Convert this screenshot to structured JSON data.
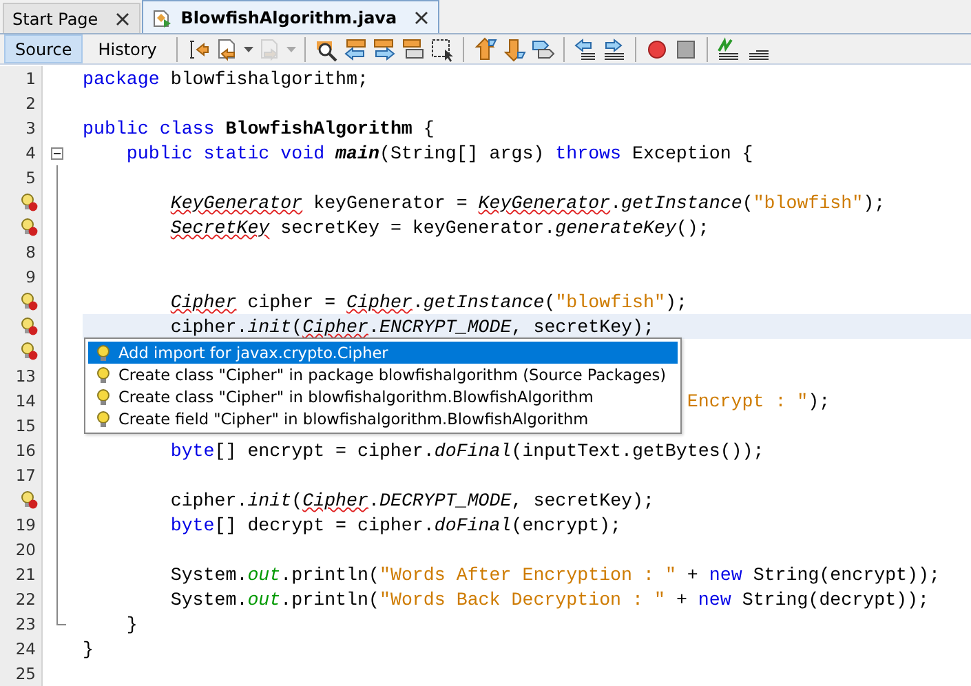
{
  "tabs": [
    {
      "label": "Start Page",
      "selected": false,
      "file_icon": false
    },
    {
      "label": "BlowfishAlgorithm.java",
      "selected": true,
      "file_icon": true
    }
  ],
  "view_buttons": [
    {
      "label": "Source",
      "selected": true
    },
    {
      "label": "History",
      "selected": false
    }
  ],
  "toolbar": [
    {
      "kind": "jump",
      "disabled": false
    },
    {
      "kind": "doc-back",
      "disabled": false,
      "dropdown": true
    },
    {
      "kind": "doc-forward",
      "disabled": true,
      "dropdown": true
    },
    {
      "kind": "sep"
    },
    {
      "kind": "search",
      "disabled": false
    },
    {
      "kind": "find-prev",
      "disabled": false
    },
    {
      "kind": "find-next",
      "disabled": false
    },
    {
      "kind": "highlight",
      "disabled": false
    },
    {
      "kind": "select",
      "disabled": false
    },
    {
      "kind": "sep"
    },
    {
      "kind": "up",
      "disabled": false
    },
    {
      "kind": "down",
      "disabled": false
    },
    {
      "kind": "tags",
      "disabled": false
    },
    {
      "kind": "sep"
    },
    {
      "kind": "shift-left",
      "disabled": false
    },
    {
      "kind": "shift-right",
      "disabled": false
    },
    {
      "kind": "sep"
    },
    {
      "kind": "record",
      "disabled": false
    },
    {
      "kind": "stop",
      "disabled": false
    },
    {
      "kind": "sep"
    },
    {
      "kind": "comment",
      "disabled": false
    },
    {
      "kind": "lines",
      "disabled": false
    }
  ],
  "lines": [
    {
      "number": "1",
      "hint": false,
      "current": false,
      "tokens": [
        {
          "kind": "kw",
          "text": "package"
        },
        {
          "kind": "text",
          "text": " blowfishalgorithm;"
        }
      ]
    },
    {
      "number": "2",
      "hint": false,
      "current": false
    },
    {
      "number": "3",
      "hint": false,
      "current": false,
      "tokens": [
        {
          "kind": "kw",
          "text": "public class"
        },
        {
          "kind": "name",
          "text": " BlowfishAlgorithm"
        },
        {
          "kind": "text",
          "text": " {"
        }
      ]
    },
    {
      "number": "4",
      "hint": false,
      "current": false,
      "fold": {
        "expanded": true
      },
      "tokens": [
        {
          "kind": "kw",
          "text": "    public static void"
        },
        {
          "kind": "name-italic",
          "text": " main"
        },
        {
          "kind": "text",
          "text": "(String[] args) "
        },
        {
          "kind": "kw",
          "text": "throws"
        },
        {
          "kind": "text",
          "text": " Exception {"
        }
      ]
    },
    {
      "number": "5",
      "hint": false,
      "current": false
    },
    {
      "hint": true,
      "current": false,
      "tokens": [
        {
          "kind": "err",
          "text": "        KeyGenerator"
        },
        {
          "kind": "text",
          "text": " keyGenerator = "
        },
        {
          "kind": "err",
          "text": "KeyGenerator"
        },
        {
          "kind": "text",
          "text": "."
        },
        {
          "kind": "method",
          "text": "getInstance"
        },
        {
          "kind": "text",
          "text": "("
        },
        {
          "kind": "str",
          "text": "\"blowfish\""
        },
        {
          "kind": "text",
          "text": ");"
        }
      ]
    },
    {
      "hint": true,
      "current": false,
      "tokens": [
        {
          "kind": "err",
          "text": "        SecretKey"
        },
        {
          "kind": "text",
          "text": " secretKey = keyGenerator."
        },
        {
          "kind": "method",
          "text": "generateKey"
        },
        {
          "kind": "text",
          "text": "();"
        }
      ]
    },
    {
      "number": "8",
      "hint": false,
      "current": false
    },
    {
      "number": "9",
      "hint": false,
      "current": false
    },
    {
      "hint": true,
      "current": false,
      "tokens": [
        {
          "kind": "err",
          "text": "        Cipher"
        },
        {
          "kind": "text",
          "text": " cipher = "
        },
        {
          "kind": "err",
          "text": "Cipher"
        },
        {
          "kind": "text",
          "text": "."
        },
        {
          "kind": "method",
          "text": "getInstance"
        },
        {
          "kind": "text",
          "text": "("
        },
        {
          "kind": "str",
          "text": "\"blowfish\""
        },
        {
          "kind": "text",
          "text": ");"
        }
      ]
    },
    {
      "hint": true,
      "current": true,
      "tokens": [
        {
          "kind": "text",
          "text": "        cipher."
        },
        {
          "kind": "method",
          "text": "init"
        },
        {
          "kind": "text",
          "text": "("
        },
        {
          "kind": "err",
          "text": "Cipher"
        },
        {
          "kind": "text",
          "text": "."
        },
        {
          "kind": "method",
          "text": "ENCRYPT_MODE"
        },
        {
          "kind": "text",
          "text": ", secretKey);"
        }
      ]
    },
    {
      "hint": true,
      "current": false
    },
    {
      "number": "13",
      "hint": false,
      "current": false
    },
    {
      "number": "14",
      "hint": false,
      "current": false,
      "covered_start": true,
      "tokens": [
        {
          "kind": "str",
          "text": "Encrypt : \""
        },
        {
          "kind": "text",
          "text": ");"
        }
      ]
    },
    {
      "number": "15",
      "hint": false,
      "current": false
    },
    {
      "number": "16",
      "hint": false,
      "current": false,
      "tokens": [
        {
          "kind": "kw",
          "text": "        byte"
        },
        {
          "kind": "text",
          "text": "[] encrypt = cipher."
        },
        {
          "kind": "method",
          "text": "doFinal"
        },
        {
          "kind": "text",
          "text": "(inputText.getBytes());"
        }
      ]
    },
    {
      "number": "17",
      "hint": false,
      "current": false
    },
    {
      "hint": true,
      "current": false,
      "tokens": [
        {
          "kind": "text",
          "text": "        cipher."
        },
        {
          "kind": "method",
          "text": "init"
        },
        {
          "kind": "text",
          "text": "("
        },
        {
          "kind": "err",
          "text": "Cipher"
        },
        {
          "kind": "text",
          "text": "."
        },
        {
          "kind": "method",
          "text": "DECRYPT_MODE"
        },
        {
          "kind": "text",
          "text": ", secretKey);"
        }
      ]
    },
    {
      "number": "19",
      "hint": false,
      "current": false,
      "tokens": [
        {
          "kind": "kw",
          "text": "        byte"
        },
        {
          "kind": "text",
          "text": "[] decrypt = cipher."
        },
        {
          "kind": "method",
          "text": "doFinal"
        },
        {
          "kind": "text",
          "text": "(encrypt);"
        }
      ]
    },
    {
      "number": "20",
      "hint": false,
      "current": false
    },
    {
      "number": "21",
      "hint": false,
      "current": false,
      "tokens": [
        {
          "kind": "text",
          "text": "        System."
        },
        {
          "kind": "field",
          "text": "out"
        },
        {
          "kind": "text",
          "text": ".println("
        },
        {
          "kind": "str",
          "text": "\"Words After Encryption : \""
        },
        {
          "kind": "text",
          "text": " + "
        },
        {
          "kind": "kw",
          "text": "new"
        },
        {
          "kind": "text",
          "text": " String(encrypt));"
        }
      ]
    },
    {
      "number": "22",
      "hint": false,
      "current": false,
      "tokens": [
        {
          "kind": "text",
          "text": "        System."
        },
        {
          "kind": "field",
          "text": "out"
        },
        {
          "kind": "text",
          "text": ".println("
        },
        {
          "kind": "str",
          "text": "\"Words Back Decryption : \""
        },
        {
          "kind": "text",
          "text": " + "
        },
        {
          "kind": "kw",
          "text": "new"
        },
        {
          "kind": "text",
          "text": " String(decrypt));"
        }
      ]
    },
    {
      "number": "23",
      "hint": false,
      "current": false,
      "fold_end": true,
      "tokens": [
        {
          "kind": "text",
          "text": "    }"
        }
      ]
    },
    {
      "number": "24",
      "hint": false,
      "current": false,
      "tokens": [
        {
          "kind": "text",
          "text": "}"
        }
      ]
    },
    {
      "number": "25",
      "hint": false,
      "current": false
    }
  ],
  "completion_popup": {
    "items": [
      {
        "label": "Add import for javax.crypto.Cipher",
        "selected": true
      },
      {
        "label": "Create class \"Cipher\" in package blowfishalgorithm (Source Packages)",
        "selected": false
      },
      {
        "label": "Create class \"Cipher\" in blowfishalgorithm.BlowfishAlgorithm",
        "selected": false
      },
      {
        "label": "Create field \"Cipher\" in blowfishalgorithm.BlowfishAlgorithm",
        "selected": false
      }
    ]
  }
}
